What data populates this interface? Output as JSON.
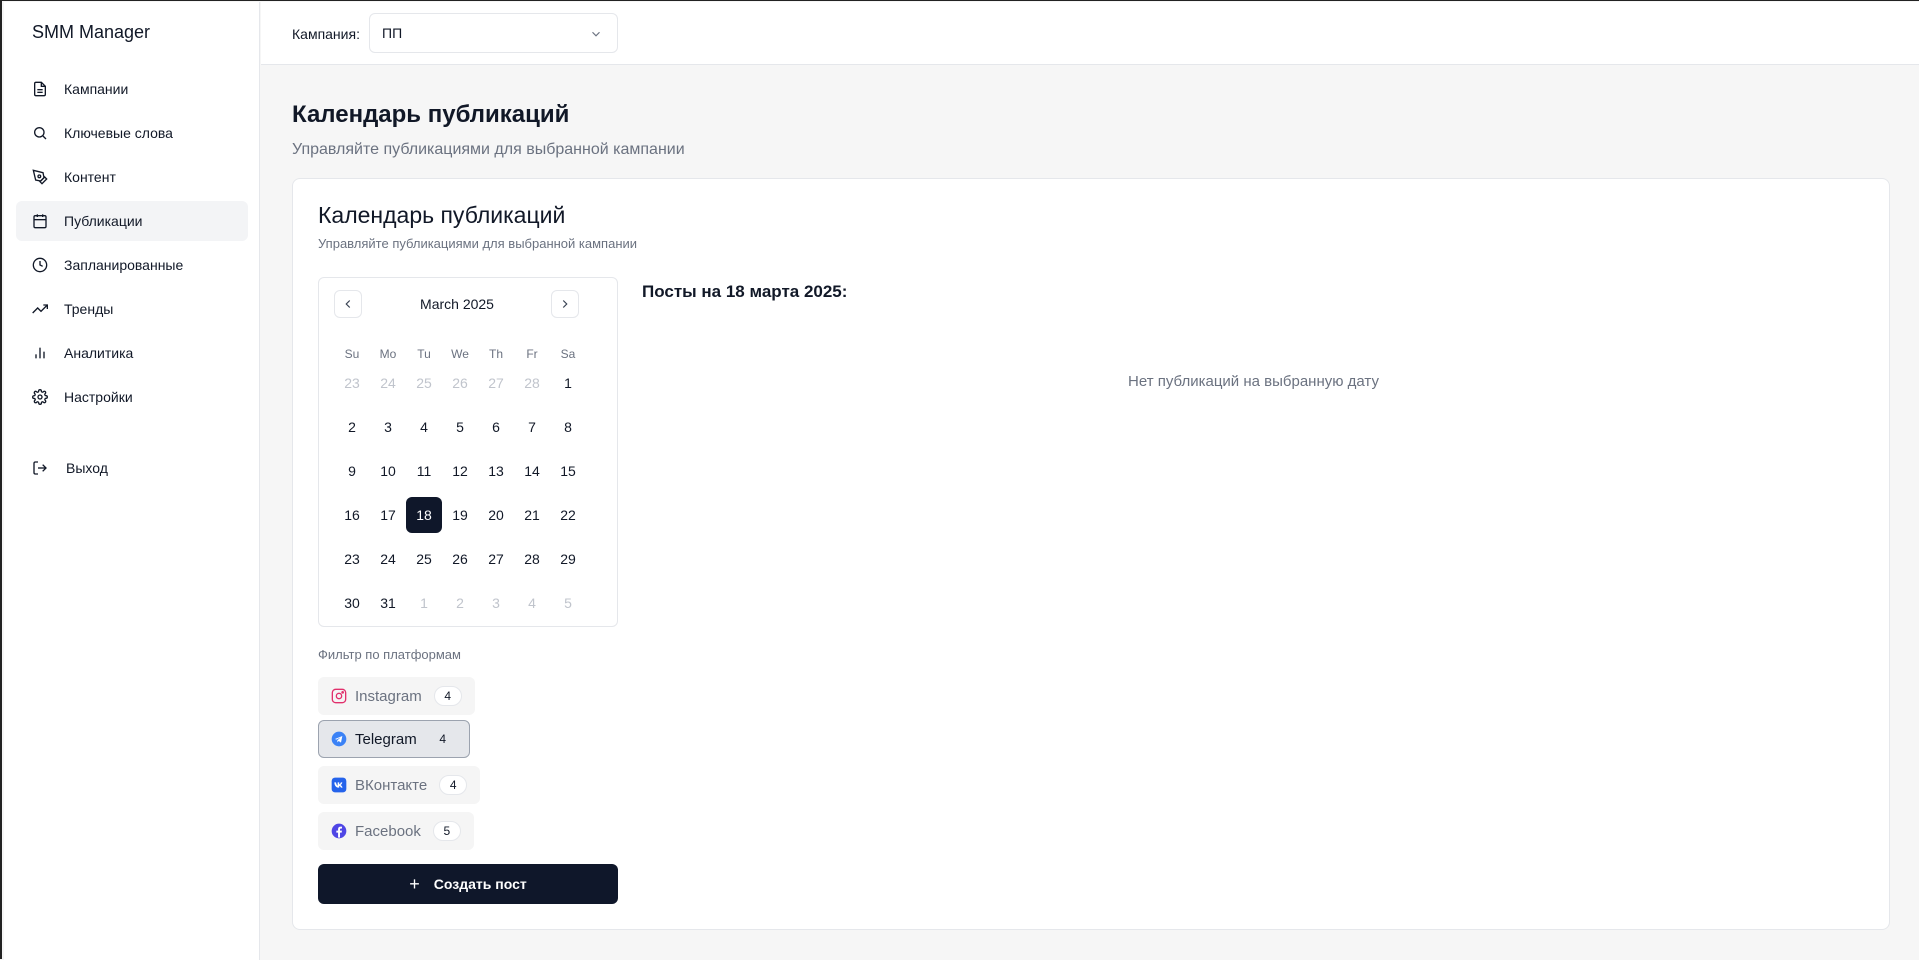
{
  "app": {
    "title": "SMM Manager"
  },
  "sidebar": {
    "items": [
      {
        "label": "Кампании",
        "icon": "document-icon"
      },
      {
        "label": "Ключевые слова",
        "icon": "search-icon"
      },
      {
        "label": "Контент",
        "icon": "pen-tool-icon"
      },
      {
        "label": "Публикации",
        "icon": "calendar-icon",
        "active": true
      },
      {
        "label": "Запланированные",
        "icon": "clock-icon"
      },
      {
        "label": "Тренды",
        "icon": "trending-up-icon"
      },
      {
        "label": "Аналитика",
        "icon": "bar-chart-icon"
      },
      {
        "label": "Настройки",
        "icon": "gear-icon"
      }
    ],
    "logout_label": "Выход"
  },
  "topbar": {
    "campaign_label": "Кампания:",
    "campaign_value": "ПП"
  },
  "page": {
    "title": "Календарь публикаций",
    "subtitle": "Управляйте публикациями для выбранной кампании"
  },
  "card": {
    "title": "Календарь публикаций",
    "subtitle": "Управляйте публикациями для выбранной кампании"
  },
  "calendar": {
    "month_label": "March 2025",
    "weekdays": [
      "Su",
      "Mo",
      "Tu",
      "We",
      "Th",
      "Fr",
      "Sa"
    ],
    "weeks": [
      [
        {
          "d": "23",
          "o": true
        },
        {
          "d": "24",
          "o": true
        },
        {
          "d": "25",
          "o": true
        },
        {
          "d": "26",
          "o": true
        },
        {
          "d": "27",
          "o": true
        },
        {
          "d": "28",
          "o": true
        },
        {
          "d": "1"
        }
      ],
      [
        {
          "d": "2"
        },
        {
          "d": "3"
        },
        {
          "d": "4"
        },
        {
          "d": "5"
        },
        {
          "d": "6"
        },
        {
          "d": "7"
        },
        {
          "d": "8"
        }
      ],
      [
        {
          "d": "9"
        },
        {
          "d": "10"
        },
        {
          "d": "11"
        },
        {
          "d": "12"
        },
        {
          "d": "13"
        },
        {
          "d": "14"
        },
        {
          "d": "15"
        }
      ],
      [
        {
          "d": "16"
        },
        {
          "d": "17"
        },
        {
          "d": "18",
          "s": true
        },
        {
          "d": "19"
        },
        {
          "d": "20"
        },
        {
          "d": "21"
        },
        {
          "d": "22"
        }
      ],
      [
        {
          "d": "23"
        },
        {
          "d": "24"
        },
        {
          "d": "25"
        },
        {
          "d": "26"
        },
        {
          "d": "27"
        },
        {
          "d": "28"
        },
        {
          "d": "29"
        }
      ],
      [
        {
          "d": "30"
        },
        {
          "d": "31"
        },
        {
          "d": "1",
          "o": true
        },
        {
          "d": "2",
          "o": true
        },
        {
          "d": "3",
          "o": true
        },
        {
          "d": "4",
          "o": true
        },
        {
          "d": "5",
          "o": true
        }
      ]
    ]
  },
  "filters": {
    "label": "Фильтр по платформам",
    "platforms": [
      {
        "name": "Instagram",
        "count": "4",
        "icon": "instagram-icon",
        "color": "#e1306c"
      },
      {
        "name": "Telegram",
        "count": "4",
        "icon": "telegram-icon",
        "color": "#3b82f6",
        "active": true
      },
      {
        "name": "ВКонтакте",
        "count": "4",
        "icon": "vk-icon",
        "color": "#2563eb"
      },
      {
        "name": "Facebook",
        "count": "5",
        "icon": "facebook-icon",
        "color": "#4f46e5"
      }
    ]
  },
  "actions": {
    "create_post": "Создать пост"
  },
  "posts": {
    "title": "Посты на 18 марта 2025:",
    "empty": "Нет публикаций на выбранную дату"
  }
}
